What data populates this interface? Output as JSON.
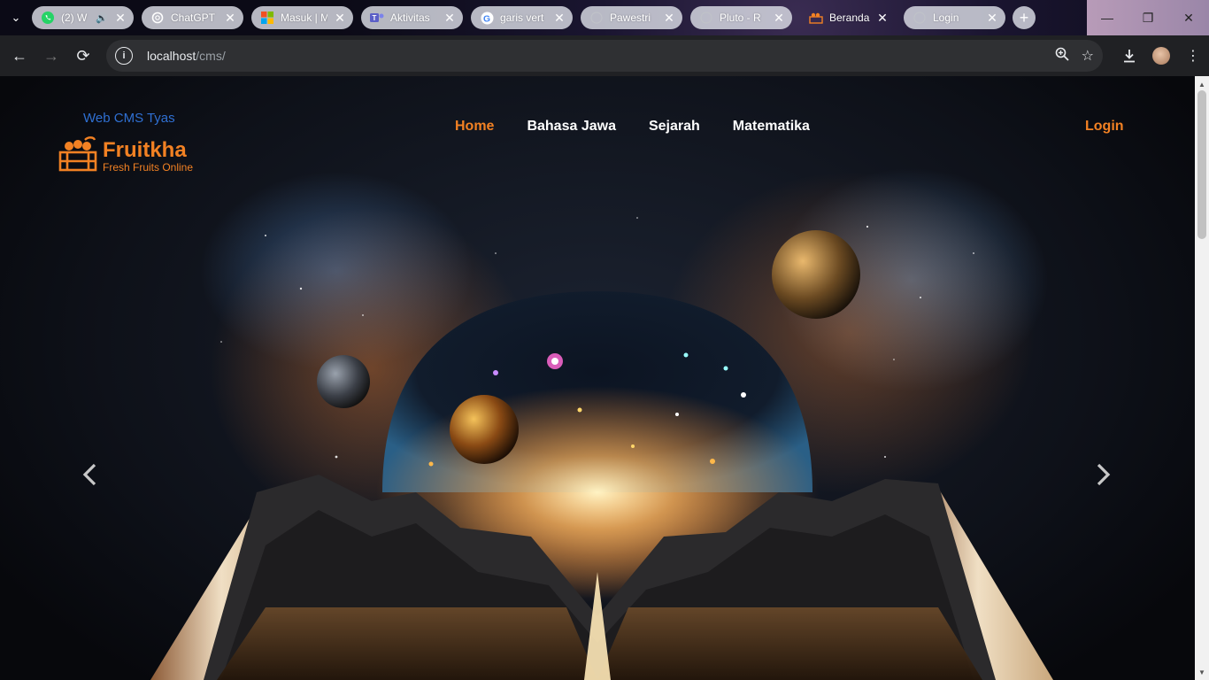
{
  "browser": {
    "tabs": [
      {
        "title": "(2) W",
        "favicon": "whatsapp-icon",
        "audio": true
      },
      {
        "title": "ChatGPT",
        "favicon": "openai-icon"
      },
      {
        "title": "Masuk | M",
        "favicon": "microsoft-icon"
      },
      {
        "title": "Aktivitas",
        "favicon": "teams-icon"
      },
      {
        "title": "garis vert",
        "favicon": "google-icon"
      },
      {
        "title": "Pawestri",
        "favicon": "globe-icon"
      },
      {
        "title": "Pluto - R",
        "favicon": "globe-icon"
      },
      {
        "title": "Beranda",
        "favicon": "fruit-basket-icon",
        "active": true
      },
      {
        "title": "Login",
        "favicon": "globe-icon"
      }
    ],
    "address": {
      "host": "localhost",
      "path": "/cms/"
    },
    "colors": {
      "toolbar": "#202124",
      "omnibox": "#2f3033"
    }
  },
  "site": {
    "cms_title": "Web CMS Tyas",
    "logo": {
      "name": "Fruitkha",
      "tagline": "Fresh Fruits Online"
    },
    "menu": [
      {
        "label": "Home",
        "active": true
      },
      {
        "label": "Bahasa Jawa"
      },
      {
        "label": "Sejarah"
      },
      {
        "label": "Matematika"
      }
    ],
    "login_label": "Login",
    "accent": "#F28123",
    "carousel": {
      "prev_icon": "chevron-left-icon",
      "next_icon": "chevron-right-icon"
    }
  }
}
